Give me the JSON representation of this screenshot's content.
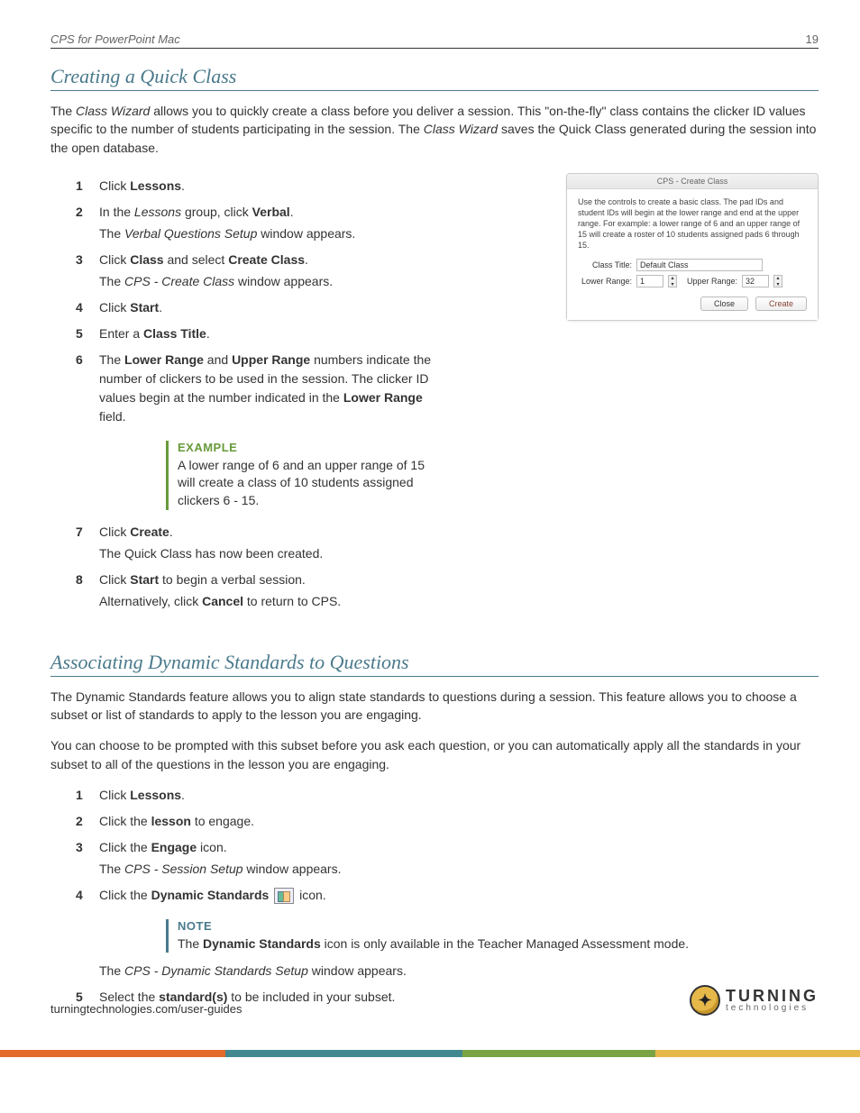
{
  "header": {
    "title": "CPS for PowerPoint Mac",
    "page": "19"
  },
  "section1": {
    "heading": "Creating a Quick Class",
    "intro_plain_pre": "The ",
    "intro_em1": "Class Wizard",
    "intro_mid1": " allows you to quickly create a class before you deliver a session. This \"on-the-fly\" class contains the clicker ID values specific to the number of students participating in the session. The ",
    "intro_em2": "Class Wizard",
    "intro_mid2": " saves the Quick Class generated during the session into the open database.",
    "steps": [
      {
        "n": "1",
        "text_pre": "Click ",
        "b1": "Lessons",
        "text_post": "."
      },
      {
        "n": "2",
        "text_pre": "In the ",
        "em1": "Lessons",
        "text_mid": " group, click ",
        "b1": "Verbal",
        "text_post": ".",
        "sub_pre": "The ",
        "sub_em": "Verbal Questions Setup",
        "sub_post": " window appears."
      },
      {
        "n": "3",
        "text_pre": "Click ",
        "b1": "Class",
        "text_mid": " and select ",
        "b2": "Create Class",
        "text_post": ".",
        "sub_pre": "The ",
        "sub_em": "CPS - Create Class",
        "sub_post": " window appears."
      },
      {
        "n": "4",
        "text_pre": "Click ",
        "b1": "Start",
        "text_post": "."
      },
      {
        "n": "5",
        "text_pre": "Enter a ",
        "b1": "Class Title",
        "text_post": "."
      },
      {
        "n": "6",
        "text_pre": "The ",
        "b1": "Lower Range",
        "text_mid": " and ",
        "b2": "Upper Range",
        "text_post": " numbers indicate the number of clickers to be used in the session. The clicker ID values begin at the number indicated in the ",
        "b3": "Lower Range",
        "text_post2": " field."
      },
      {
        "n": "7",
        "text_pre": "Click ",
        "b1": "Create",
        "text_post": ".",
        "sub_plain": "The Quick Class has now been created."
      },
      {
        "n": "8",
        "text_pre": "Click ",
        "b1": "Start",
        "text_mid": " to begin a verbal session.",
        "sub_pre": "Alternatively, click ",
        "sub_b": "Cancel",
        "sub_post": " to return to CPS."
      }
    ],
    "example": {
      "title": "EXAMPLE",
      "body": "A lower range of 6 and an upper range of 15 will create a class of 10 students assigned clickers 6 - 15."
    },
    "dialog": {
      "titlebar": "CPS - Create Class",
      "instructions": "Use the controls to create a basic class. The pad IDs and student IDs will begin at the lower range and end at the upper range. For example: a lower range of 6 and an upper range of 15 will create a roster of 10 students assigned pads 6 through 15.",
      "class_title_label": "Class Title:",
      "class_title_value": "Default Class",
      "lower_label": "Lower Range:",
      "lower_value": "1",
      "upper_label": "Upper Range:",
      "upper_value": "32",
      "btn_close": "Close",
      "btn_create": "Create"
    }
  },
  "section2": {
    "heading": "Associating Dynamic Standards to Questions",
    "p1": "The Dynamic Standards feature allows you to align state standards to questions during a session. This feature allows you to choose a subset or list of standards to apply to the lesson you are engaging.",
    "p2": "You can choose to be prompted with this subset before you ask each question, or you can automatically apply all the standards in your subset to all of the questions in the lesson you are engaging.",
    "steps": [
      {
        "n": "1",
        "text_pre": "Click ",
        "b1": "Lessons",
        "text_post": "."
      },
      {
        "n": "2",
        "text_pre": "Click the ",
        "b1": "lesson",
        "text_post": " to engage."
      },
      {
        "n": "3",
        "text_pre": "Click the ",
        "b1": "Engage",
        "text_post": " icon.",
        "sub_pre": "The ",
        "sub_em": "CPS - Session Setup",
        "sub_post": " window appears."
      },
      {
        "n": "4",
        "text_pre": "Click the ",
        "b1": "Dynamic Standards",
        "text_post": " icon.",
        "has_icon": true
      },
      {
        "n": "5",
        "text_pre": "Select the ",
        "b1": "standard(s)",
        "text_post": " to be included in your subset."
      }
    ],
    "note": {
      "title": "NOTE",
      "body_pre": "The ",
      "body_b": "Dynamic Standards",
      "body_post": " icon is only available in the Teacher Managed Assessment mode."
    },
    "after_note_pre": "The ",
    "after_note_em": "CPS - Dynamic Standards Setup",
    "after_note_post": " window appears."
  },
  "footer": {
    "url": "turningtechnologies.com/user-guides",
    "logo_line1": "TURNING",
    "logo_line2": "technologies"
  }
}
